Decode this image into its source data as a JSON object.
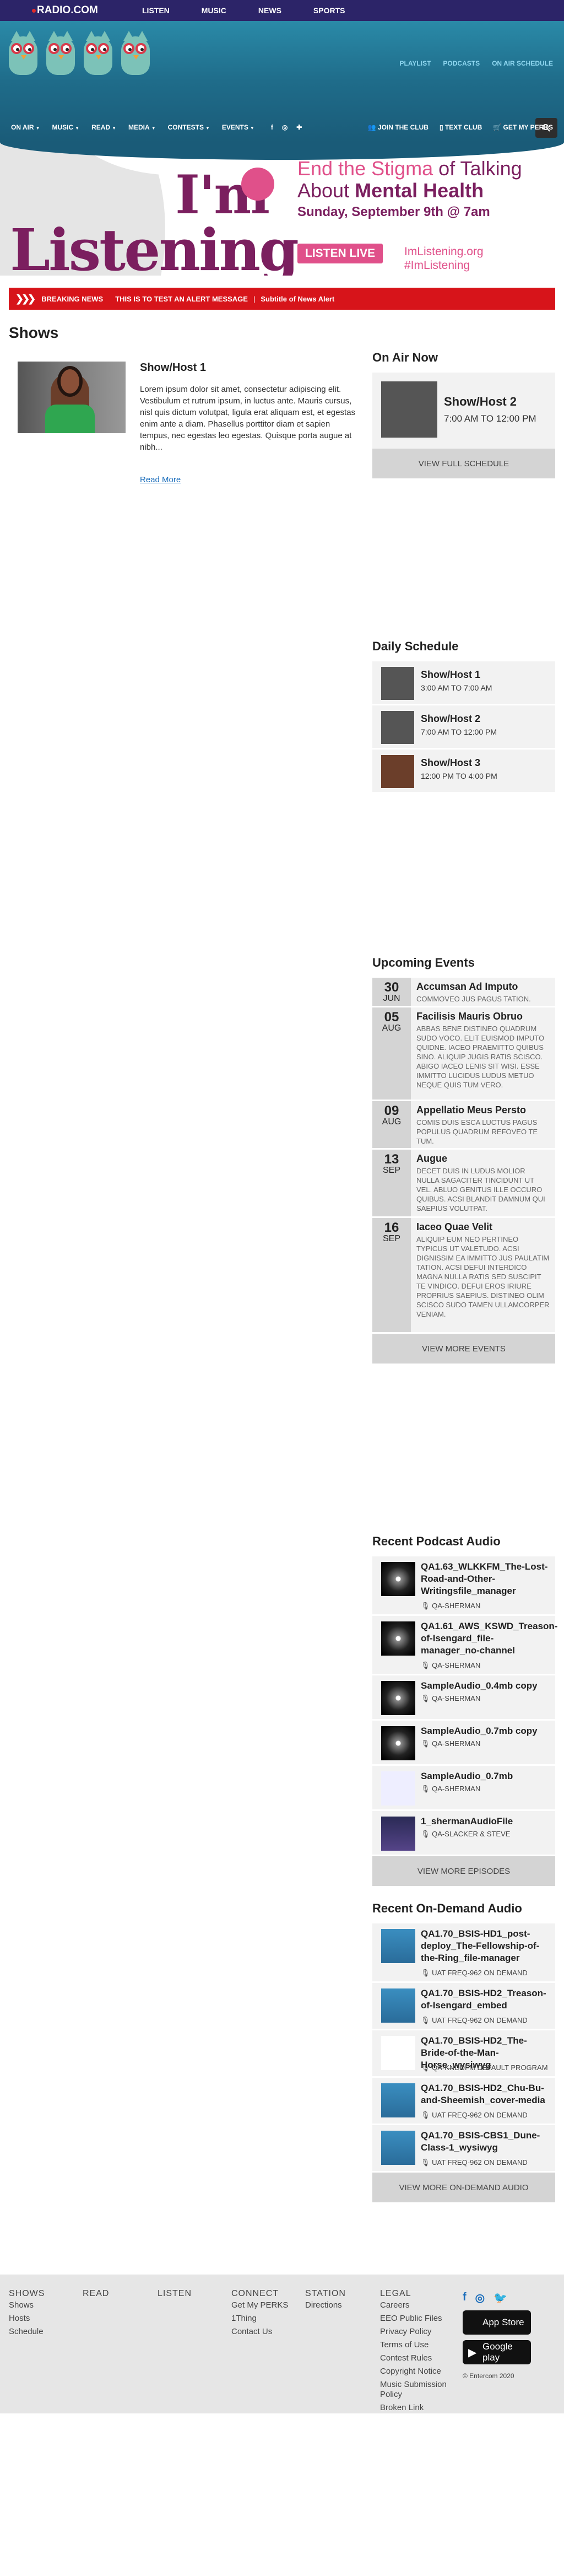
{
  "topnav": {
    "brand": "RADIO.COM",
    "items": [
      "LISTEN",
      "MUSIC",
      "NEWS",
      "SPORTS"
    ]
  },
  "header": {
    "links": [
      "PLAYLIST",
      "PODCASTS",
      "ON AIR SCHEDULE"
    ],
    "mainnav": [
      "ON AIR",
      "MUSIC",
      "READ",
      "MEDIA",
      "CONTESTS",
      "EVENTS"
    ],
    "subnav": [
      "JOIN THE CLUB",
      "TEXT CLUB",
      "GET MY PERKS"
    ]
  },
  "banner": {
    "im": "I'm",
    "listening": "Listening",
    "line1a": "End the Stigma",
    "line1b": "of Talking",
    "line2a": "About",
    "line2b": "Mental Health",
    "line3": "Sunday, September 9th @ 7am",
    "button": "LISTEN LIVE",
    "url": "ImListening.org",
    "hashtag": "#ImListening"
  },
  "breaking": {
    "label": "BREAKING NEWS",
    "message": "THIS IS TO TEST AN ALERT MESSAGE",
    "sep": "|",
    "subtitle": "Subtitle of News Alert"
  },
  "main": {
    "title": "Shows",
    "show": {
      "name": "Show/Host 1",
      "desc": "Lorem ipsum dolor sit amet, consectetur adipiscing elit. Vestibulum et rutrum ipsum, in luctus ante. Mauris cursus, nisl quis dictum volutpat, ligula erat aliquam est, et egestas enim ante a diam. Phasellus porttitor diam et sapien tempus, nec egestas leo egestas. Quisque porta augue at nibh...",
      "readmore": "Read More"
    }
  },
  "onair": {
    "title": "On Air Now",
    "name": "Show/Host 2",
    "time": "7:00 AM TO 12:00 PM",
    "button": "VIEW FULL SCHEDULE"
  },
  "schedule": {
    "title": "Daily Schedule",
    "items": [
      {
        "name": "Show/Host 1",
        "time": "3:00 AM TO 7:00 AM"
      },
      {
        "name": "Show/Host 2",
        "time": "7:00 AM TO 12:00 PM"
      },
      {
        "name": "Show/Host 3",
        "time": "12:00 PM TO 4:00 PM"
      }
    ]
  },
  "events": {
    "title": "Upcoming Events",
    "button": "VIEW MORE EVENTS",
    "items": [
      {
        "day": "30",
        "mon": "JUN",
        "name": "Accumsan Ad Imputo",
        "desc": "COMMOVEO JUS PAGUS TATION."
      },
      {
        "day": "05",
        "mon": "AUG",
        "name": "Facilisis Mauris Obruo",
        "desc": "ABBAS BENE DISTINEO QUADRUM SUDO VOCO. ELIT EUISMOD IMPUTO QUIDNE. IACEO PRAEMITTO QUIBUS SINO. ALIQUIP JUGIS RATIS SCISCO. ABIGO IACEO LENIS SIT WISI. ESSE IMMITTO LUCIDUS LUDUS METUO NEQUE QUIS TUM VERO."
      },
      {
        "day": "09",
        "mon": "AUG",
        "name": "Appellatio Meus Persto",
        "desc": "COMIS DUIS ESCA LUCTUS PAGUS POPULUS QUADRUM REFOVEO TE TUM."
      },
      {
        "day": "13",
        "mon": "SEP",
        "name": "Augue",
        "desc": "DECET DUIS IN LUDUS MOLIOR NULLA SAGACITER TINCIDUNT UT VEL. ABLUO GENITUS ILLE OCCURO QUIBUS. ACSI BLANDIT DAMNUM QUI SAEPIUS VOLUTPAT."
      },
      {
        "day": "16",
        "mon": "SEP",
        "name": "Iaceo Quae Velit",
        "desc": "ALIQUIP EUM NEO PERTINEO TYPICUS UT VALETUDO. ACSI DIGNISSIM EA IMMITTO JUS PAULATIM TATION. ACSI DEFUI INTERDICO MAGNA NULLA RATIS SED SUSCIPIT TE VINDICO. DEFUI EROS IRIURE PROPRIUS SAEPIUS. DISTINEO OLIM SCISCO SUDO TAMEN ULLAMCORPER VENIAM."
      }
    ]
  },
  "podcasts": {
    "title": "Recent Podcast Audio",
    "button": "VIEW MORE EPISODES",
    "items": [
      {
        "title": "QA1.63_WLKKFM_The-Lost-Road-and-Other-Writingsfile_manager",
        "by": "QA-SHERMAN"
      },
      {
        "title": "QA1.61_AWS_KSWD_Treason-of-Isengard_file-manager_no-channel",
        "by": "QA-SHERMAN"
      },
      {
        "title": "SampleAudio_0.4mb copy",
        "by": "QA-SHERMAN"
      },
      {
        "title": "SampleAudio_0.7mb copy",
        "by": "QA-SHERMAN"
      },
      {
        "title": "SampleAudio_0.7mb",
        "by": "QA-SHERMAN"
      },
      {
        "title": "1_shermanAudioFile",
        "by": "QA-SLACKER & STEVE"
      }
    ]
  },
  "ondemand": {
    "title": "Recent On-Demand Audio",
    "button": "VIEW MORE ON-DEMAND AUDIO",
    "items": [
      {
        "title": "QA1.70_BSIS-HD1_post-deploy_The-Fellowship-of-the-Ring_file-manager",
        "by": "UAT FREQ-962 ON DEMAND"
      },
      {
        "title": "QA1.70_BSIS-HD2_Treason-of-Isengard_embed",
        "by": "UAT FREQ-962 ON DEMAND"
      },
      {
        "title": "QA1.70_BSIS-HD2_The-Bride-of-the-Man-Horse_wysiwyg",
        "by": "QA-KNDDFM DEFAULT PROGRAM"
      },
      {
        "title": "QA1.70_BSIS-HD2_Chu-Bu-and-Sheemish_cover-media",
        "by": "UAT FREQ-962 ON DEMAND"
      },
      {
        "title": "QA1.70_BSIS-CBS1_Dune-Class-1_wysiwyg",
        "by": "UAT FREQ-962 ON DEMAND"
      }
    ]
  },
  "footer": {
    "shows": {
      "head": "SHOWS",
      "links": [
        "Shows",
        "Hosts",
        "Schedule"
      ]
    },
    "read": {
      "head": "READ"
    },
    "listen": {
      "head": "LISTEN"
    },
    "connect": {
      "head": "CONNECT",
      "links": [
        "Get My PERKS",
        "1Thing",
        "Contact Us"
      ]
    },
    "station": {
      "head": "STATION",
      "links": [
        "Directions"
      ]
    },
    "legal": {
      "head": "LEGAL",
      "links": [
        "Careers",
        "EEO Public Files",
        "Privacy Policy",
        "Terms of Use",
        "Contest Rules",
        "Copyright Notice",
        "Music Submission Policy",
        "Broken Link"
      ]
    },
    "appstore": "App Store",
    "googleplay": "Google play",
    "copyright": "© Entercom 2020"
  }
}
